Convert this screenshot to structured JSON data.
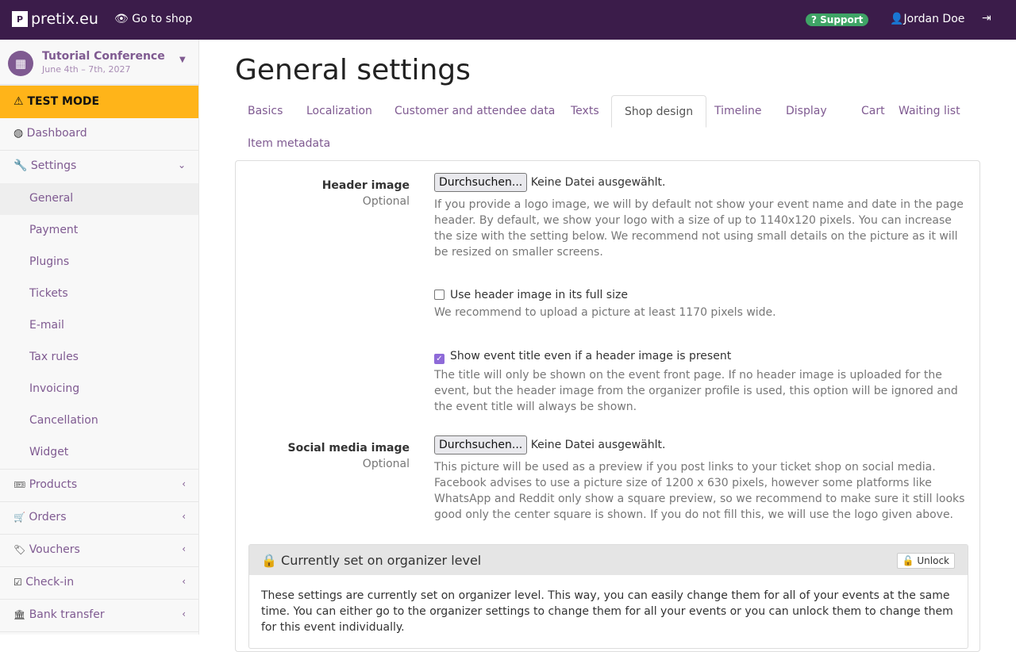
{
  "topbar": {
    "brand": "pretix.eu",
    "go_to_shop": "Go to shop",
    "support": "Support",
    "user": "Jordan Doe"
  },
  "event": {
    "name": "Tutorial Conference",
    "date": "June 4th – 7th, 2027"
  },
  "test_mode": "TEST MODE",
  "sidebar": {
    "dashboard": "Dashboard",
    "settings": "Settings",
    "settings_items": [
      "General",
      "Payment",
      "Plugins",
      "Tickets",
      "E-mail",
      "Tax rules",
      "Invoicing",
      "Cancellation",
      "Widget"
    ],
    "bottom": [
      {
        "label": "Products",
        "icon": "ticket"
      },
      {
        "label": "Orders",
        "icon": "cart"
      },
      {
        "label": "Vouchers",
        "icon": "tags"
      },
      {
        "label": "Check-in",
        "icon": "check-square"
      },
      {
        "label": "Bank transfer",
        "icon": "bank"
      }
    ]
  },
  "page": {
    "title": "General settings"
  },
  "tabs": [
    "Basics",
    "Localization",
    "Customer and attendee data",
    "Texts",
    "Shop design",
    "Timeline",
    "Display",
    "Cart",
    "Waiting list",
    "Item metadata"
  ],
  "active_tab": "Shop design",
  "form": {
    "header_image": {
      "label": "Header image",
      "optional": "Optional",
      "button": "Durchsuchen...",
      "file": "Keine Datei ausgewählt.",
      "help": "If you provide a logo image, we will by default not show your event name and date in the page header. By default, we show your logo with a size of up to 1140x120 pixels. You can increase the size with the setting below. We recommend not using small details on the picture as it will be resized on smaller screens."
    },
    "full_size": {
      "label": "Use header image in its full size",
      "checked": false,
      "help": "We recommend to upload a picture at least 1170 pixels wide."
    },
    "show_title": {
      "label": "Show event title even if a header image is present",
      "checked": true,
      "help": "The title will only be shown on the event front page. If no header image is uploaded for the event, but the header image from the organizer profile is used, this option will be ignored and the event title will always be shown."
    },
    "social_image": {
      "label": "Social media image",
      "optional": "Optional",
      "button": "Durchsuchen...",
      "file": "Keine Datei ausgewählt.",
      "help": "This picture will be used as a preview if you post links to your ticket shop on social media. Facebook advises to use a picture size of 1200 x 630 pixels, however some platforms like WhatsApp and Reddit only show a square preview, so we recommend to make sure it still looks good only the center square is shown. If you do not fill this, we will use the logo given above."
    }
  },
  "organizer_lock": {
    "title": "Currently set on organizer level",
    "unlock": "Unlock",
    "text": "These settings are currently set on organizer level. This way, you can easily change them for all of your events at the same time. You can either go to the organizer settings to change them for all your events or you can unlock them to change them for this event individually."
  }
}
